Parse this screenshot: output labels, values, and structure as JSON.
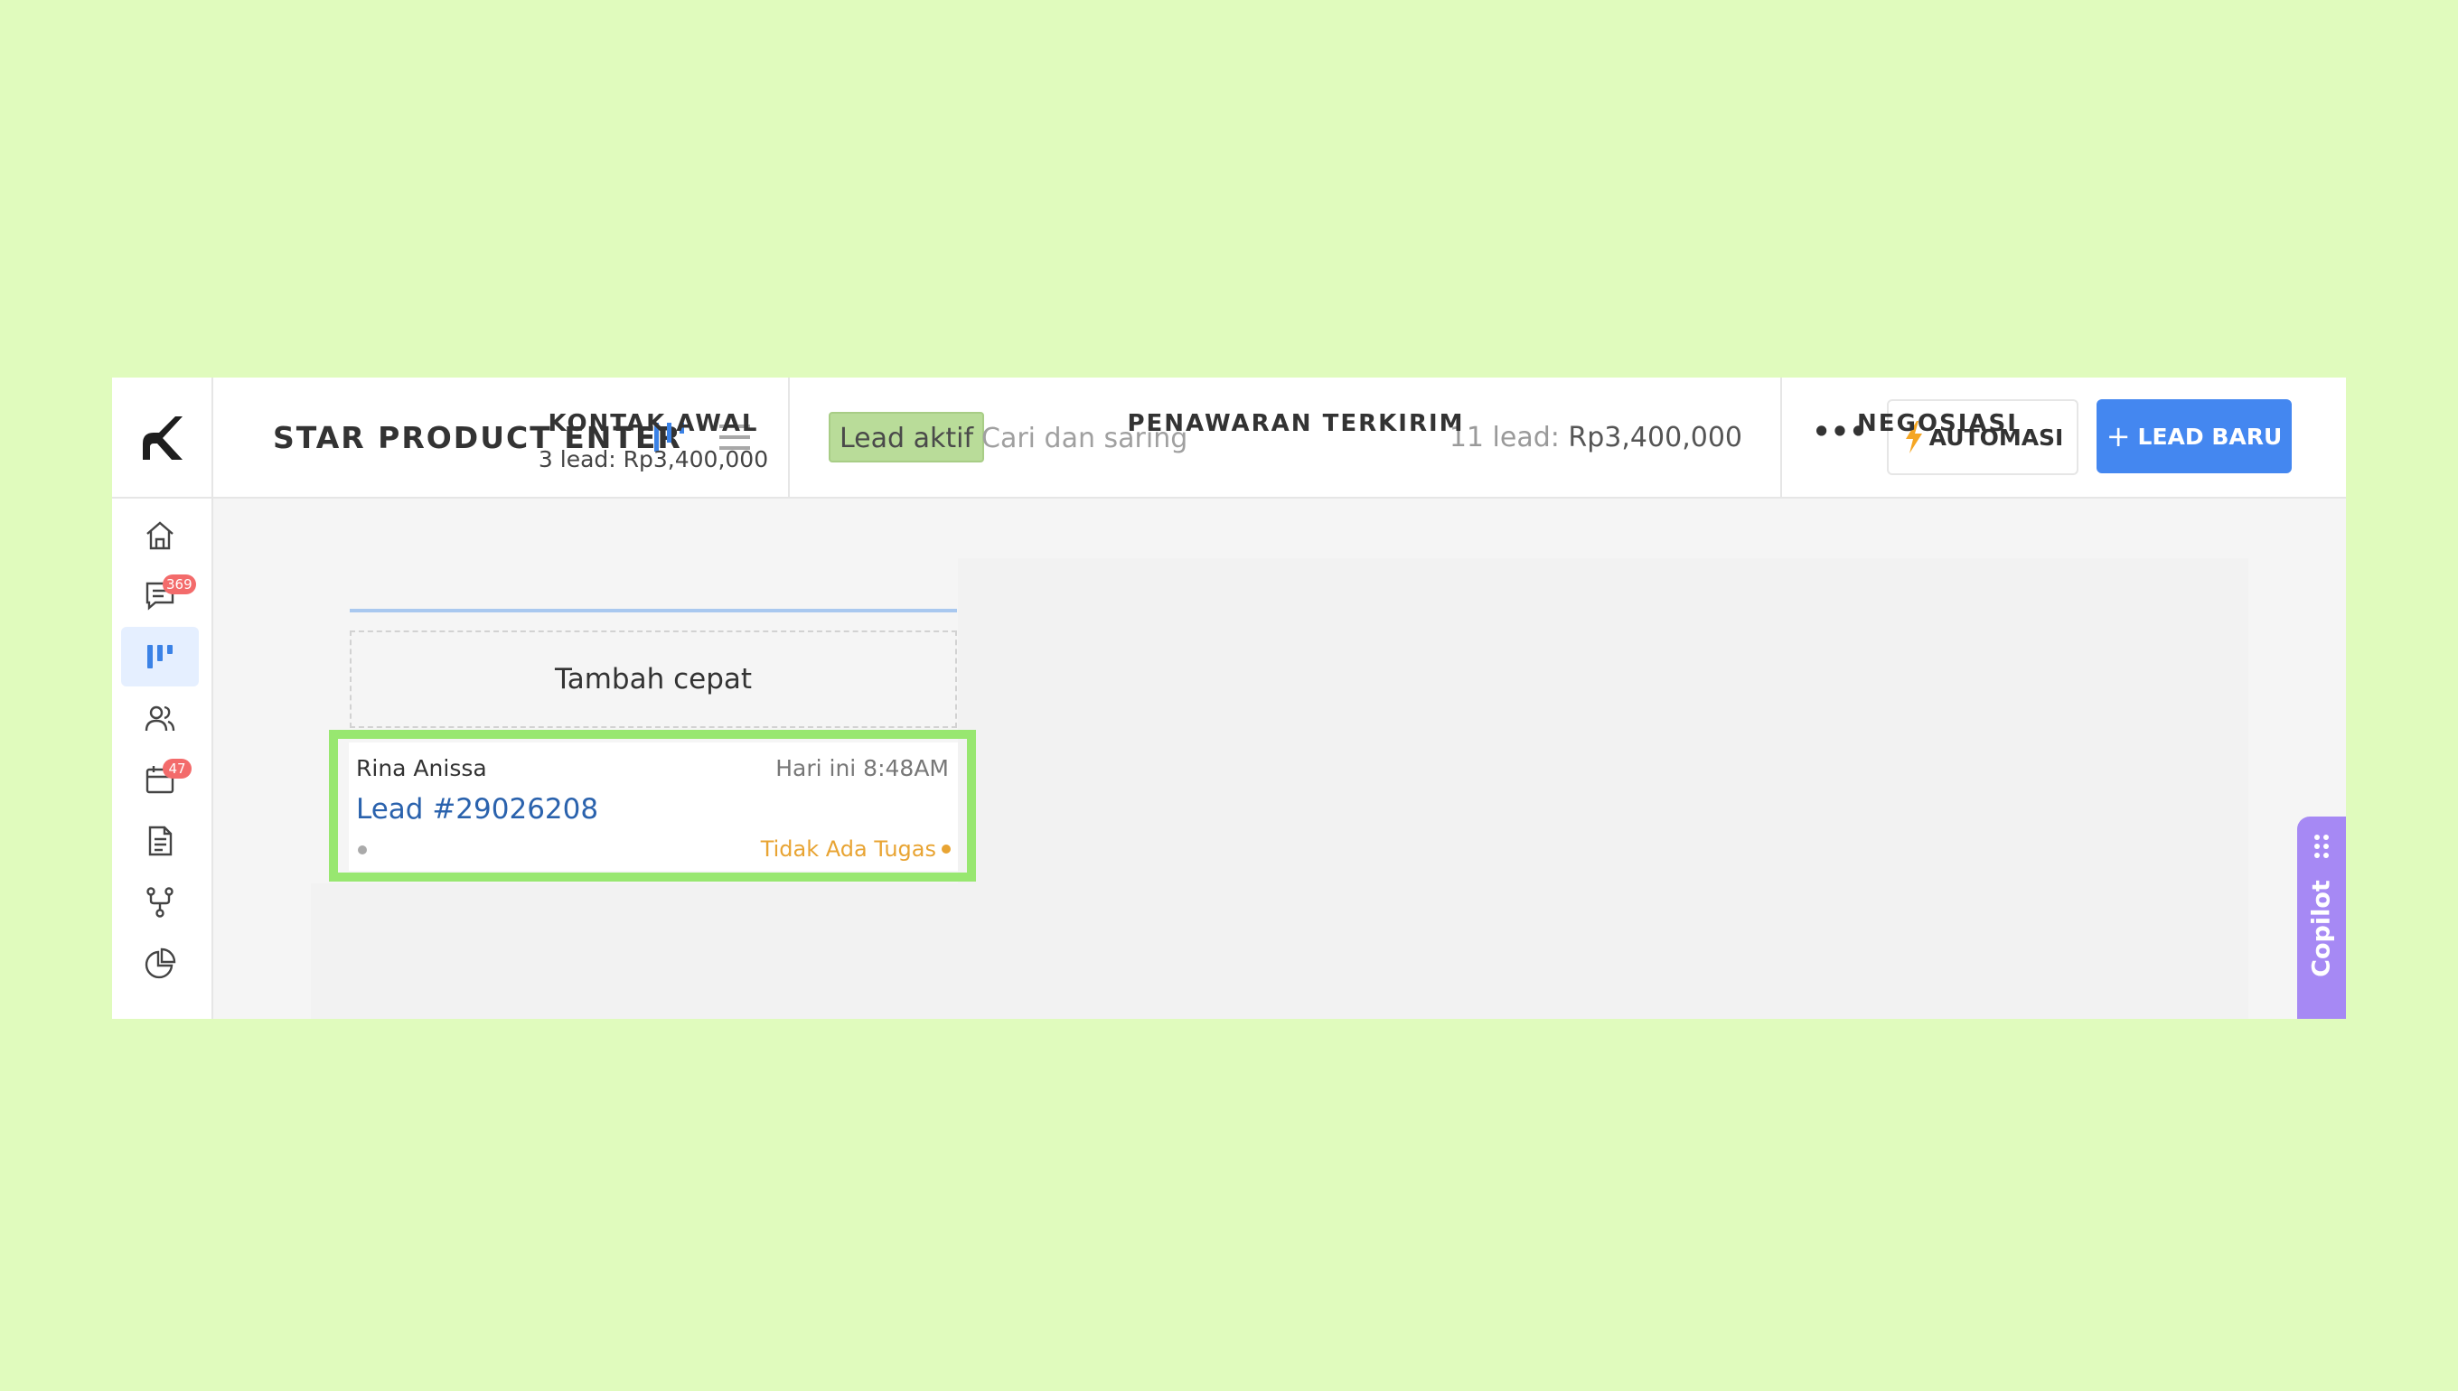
{
  "header": {
    "pipeline_title": "STAR PRODUCT ENTER",
    "filter_chip": "Lead aktif",
    "search_placeholder": "Cari dan saring",
    "lead_count_label": "11 lead:",
    "lead_total_amount": "Rp3,400,000",
    "more_label": "•••",
    "automation_label": "AUTOMASI",
    "new_lead_label": "LEAD BARU",
    "new_lead_plus": "+"
  },
  "sidebar": {
    "items": [
      {
        "icon": "home-icon"
      },
      {
        "icon": "chat-icon",
        "badge": "369"
      },
      {
        "icon": "pipeline-icon",
        "active": true
      },
      {
        "icon": "contacts-icon"
      },
      {
        "icon": "calendar-icon",
        "badge": "47"
      },
      {
        "icon": "document-icon"
      },
      {
        "icon": "workflow-icon"
      },
      {
        "icon": "report-icon"
      }
    ]
  },
  "board": {
    "columns": [
      {
        "title": "KONTAK AWAL",
        "summary": "3 lead: Rp3,400,000"
      },
      {
        "title": "PENAWARAN TERKIRIM"
      },
      {
        "title": "NEGOSIASI"
      }
    ],
    "quick_add_label": "Tambah cepat",
    "card": {
      "contact_name": "Rina Anissa",
      "timestamp": "Hari ini 8:48AM",
      "lead_title": "Lead #29026208",
      "task_status": "Tidak Ada Tugas"
    }
  },
  "copilot": {
    "label": "Copilot"
  },
  "colors": {
    "background": "#e0fbbd",
    "primary_button": "#4487f0",
    "highlight_border": "#98e770",
    "copilot": "#a689f4",
    "filter_chip": "#b9dc99",
    "task_warning": "#e8a433",
    "lead_link": "#2a62ad"
  }
}
